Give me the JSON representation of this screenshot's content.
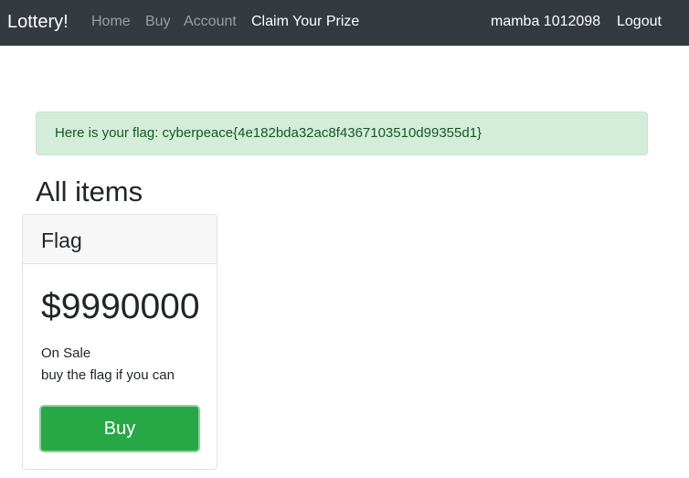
{
  "navbar": {
    "brand": "Lottery!",
    "links": [
      {
        "label": "Home"
      },
      {
        "label": "Buy"
      },
      {
        "label": "Account"
      },
      {
        "label": "Claim Your Prize"
      }
    ],
    "user": "mamba 1012098",
    "logout": "Logout"
  },
  "alert": {
    "text": "Here is your flag: cyberpeace{4e182bda32ac8f4367103510d99355d1}"
  },
  "main": {
    "title": "All items"
  },
  "card": {
    "header": "Flag",
    "price": "$9990000",
    "status": "On Sale",
    "description": "buy the flag if you can",
    "button": "Buy"
  },
  "colors": {
    "navbar": "#343a40",
    "alert_bg": "#d4edda",
    "alert_text": "#155724",
    "button": "#28a745"
  }
}
